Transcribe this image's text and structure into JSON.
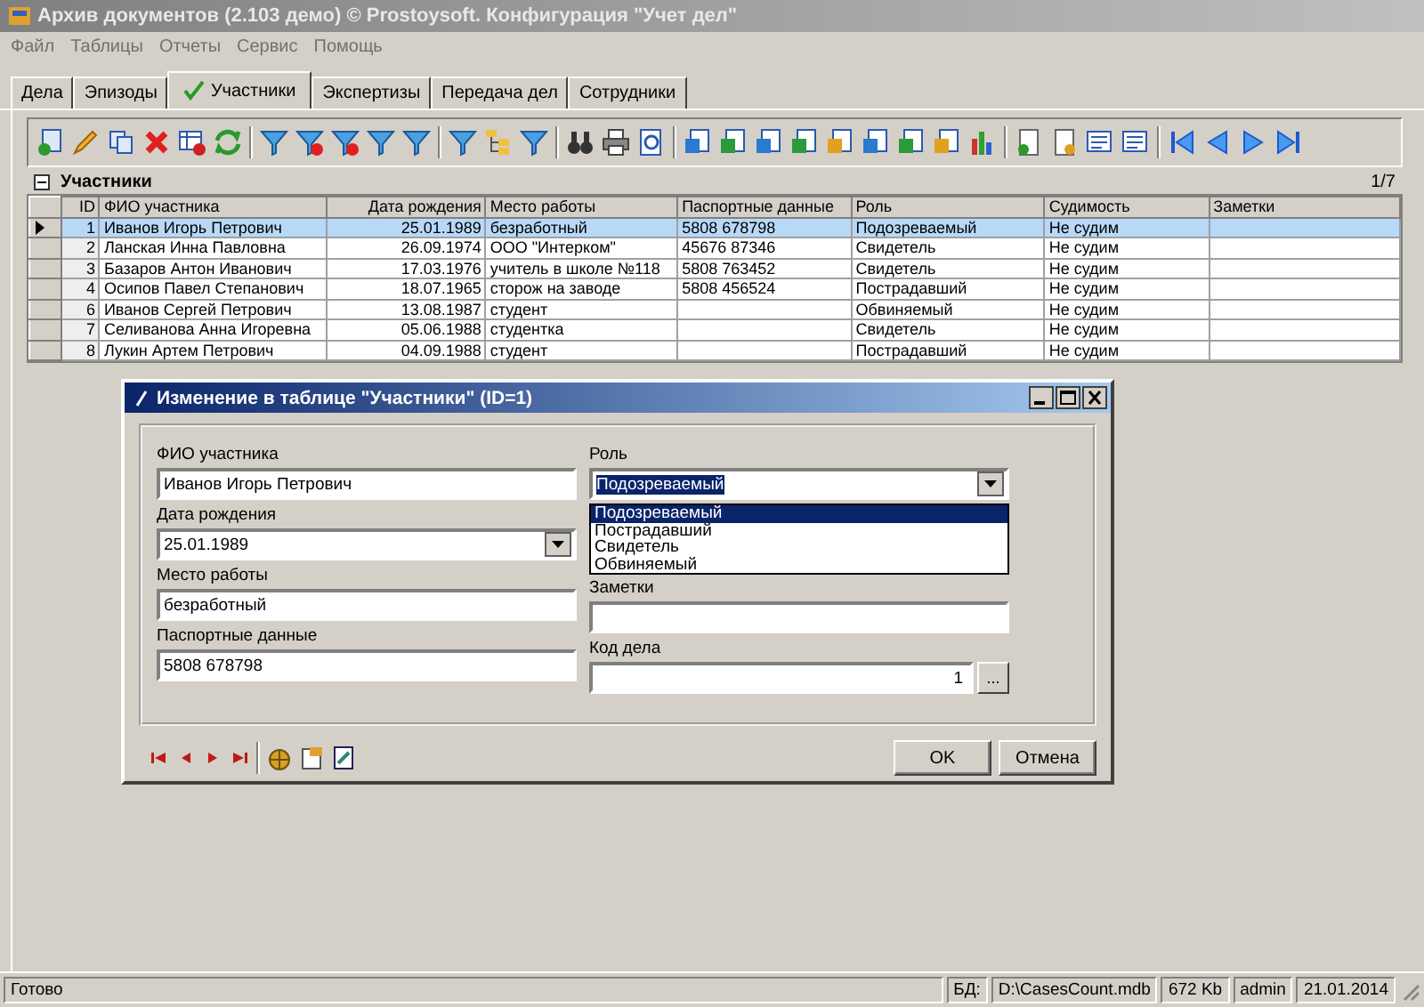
{
  "window": {
    "title": "Архив документов (2.103 демо) © Prostoysoft. Конфигурация \"Учет дел\""
  },
  "menu": [
    "Файл",
    "Таблицы",
    "Отчеты",
    "Сервис",
    "Помощь"
  ],
  "tabs": [
    {
      "label": "Дела",
      "selected": false
    },
    {
      "label": "Эпизоды",
      "selected": false
    },
    {
      "label": "Участники",
      "selected": true
    },
    {
      "label": "Экспертизы",
      "selected": false
    },
    {
      "label": "Передача дел",
      "selected": false
    },
    {
      "label": "Сотрудники",
      "selected": false
    }
  ],
  "pane": {
    "title": "Участники",
    "counter": "1/7"
  },
  "table": {
    "columns": [
      "ID",
      "ФИО участника",
      "Дата рождения",
      "Место работы",
      "Паспортные данные",
      "Роль",
      "Судимость",
      "Заметки"
    ],
    "rows": [
      {
        "selected": true,
        "cells": [
          "1",
          "Иванов Игорь Петрович",
          "25.01.1989",
          "безработный",
          "5808 678798",
          "Подозреваемый",
          "Не судим"
        ]
      },
      {
        "selected": false,
        "cells": [
          "2",
          "Ланская Инна Павловна",
          "26.09.1974",
          "ООО \"Интерком\"",
          "45676 87346",
          "Свидетель",
          "Не судим"
        ]
      },
      {
        "selected": false,
        "cells": [
          "3",
          "Базаров Антон Иванович",
          "17.03.1976",
          "учитель в школе №118",
          "5808 763452",
          "Свидетель",
          "Не судим"
        ]
      },
      {
        "selected": false,
        "cells": [
          "4",
          "Осипов Павел Степанович",
          "18.07.1965",
          "сторож на заводе",
          "5808 456524",
          "Пострадавший",
          "Не судим"
        ]
      },
      {
        "selected": false,
        "cells": [
          "6",
          "Иванов Сергей Петрович",
          "13.08.1987",
          "студент",
          "",
          "Обвиняемый",
          "Не судим"
        ]
      },
      {
        "selected": false,
        "cells": [
          "7",
          "Селиванова Анна Игоревна",
          "05.06.1988",
          "студентка",
          "",
          "Свидетель",
          "Не судим"
        ]
      },
      {
        "selected": false,
        "cells": [
          "8",
          "Лукин Артем Петрович",
          "04.09.1988",
          "студент",
          "",
          "Пострадавший",
          "Не судим"
        ]
      }
    ]
  },
  "dialog": {
    "title": "Изменение в таблице \"Участники\" (ID=1)",
    "left_fields": [
      {
        "kind": "text",
        "label": "ФИО участника",
        "value": "Иванов Игорь Петрович"
      },
      {
        "kind": "date",
        "label": "Дата рождения",
        "value": "25.01.1989"
      },
      {
        "kind": "text",
        "label": "Место работы",
        "value": "безработный"
      },
      {
        "kind": "text",
        "label": "Паспортные данные",
        "value": "5808 678798"
      }
    ],
    "right_fields": [
      {
        "kind": "combo",
        "label": "Роль",
        "value": "Подозреваемый",
        "options": [
          {
            "label": "Подозреваемый",
            "selected": true
          },
          {
            "label": "Пострадавший",
            "selected": false
          },
          {
            "label": "Свидетель",
            "selected": false
          },
          {
            "label": "Обвиняемый",
            "selected": false
          }
        ]
      },
      {
        "kind": "text",
        "label": "Заметки"
      },
      {
        "kind": "lookup",
        "label": "Код дела",
        "value": "1",
        "button": "..."
      }
    ],
    "buttons": [
      "OK",
      "Отмена"
    ]
  },
  "status_bar": {
    "message": "Готово",
    "db_label": "БД:",
    "db_path": "D:\\CasesCount.mdb",
    "size": "672 Kb",
    "user": "admin",
    "date": "21.01.2014"
  }
}
